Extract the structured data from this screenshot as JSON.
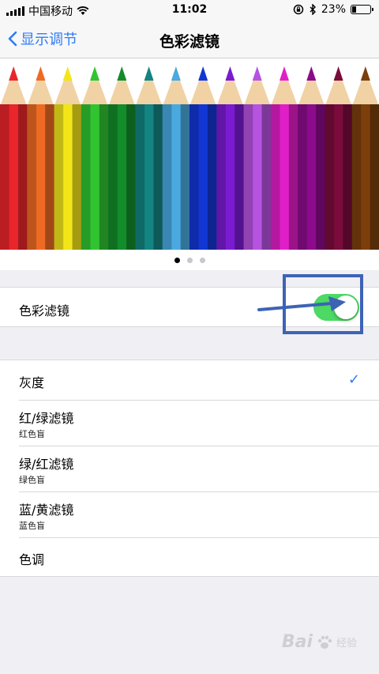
{
  "status": {
    "carrier": "中国移动",
    "time": "11:02",
    "battery_percent": "23%",
    "battery_level": 0.23,
    "icons": [
      "signal-icon",
      "wifi-icon",
      "rotation-lock-icon",
      "bluetooth-icon",
      "battery-icon"
    ]
  },
  "nav": {
    "back_label": "显示调节",
    "title": "色彩滤镜"
  },
  "banner": {
    "pencil_colors": [
      "#e8262b",
      "#ee6a23",
      "#f2e61a",
      "#31c431",
      "#138c2b",
      "#138481",
      "#49a9e0",
      "#1136d4",
      "#7a1bd2",
      "#b653e0",
      "#e21ec8",
      "#8c0b8c",
      "#7a0b3c",
      "#7c3f0c"
    ],
    "page_dots": 3,
    "active_dot": 0
  },
  "toggle_row": {
    "label": "色彩滤镜",
    "enabled": true,
    "toggle_color": "#4cd964"
  },
  "options": [
    {
      "title": "灰度",
      "subtitle": "",
      "selected": true
    },
    {
      "title": "红/绿滤镜",
      "subtitle": "红色盲",
      "selected": false
    },
    {
      "title": "绿/红滤镜",
      "subtitle": "绿色盲",
      "selected": false
    },
    {
      "title": "蓝/黄滤镜",
      "subtitle": "蓝色盲",
      "selected": false
    },
    {
      "title": "色调",
      "subtitle": "",
      "selected": false
    }
  ],
  "checkmark": "✓",
  "watermark": {
    "brand": "Bai",
    "suffix": "经验"
  },
  "colors": {
    "accent": "#2f7cf6",
    "annotation": "#3d63b5"
  }
}
